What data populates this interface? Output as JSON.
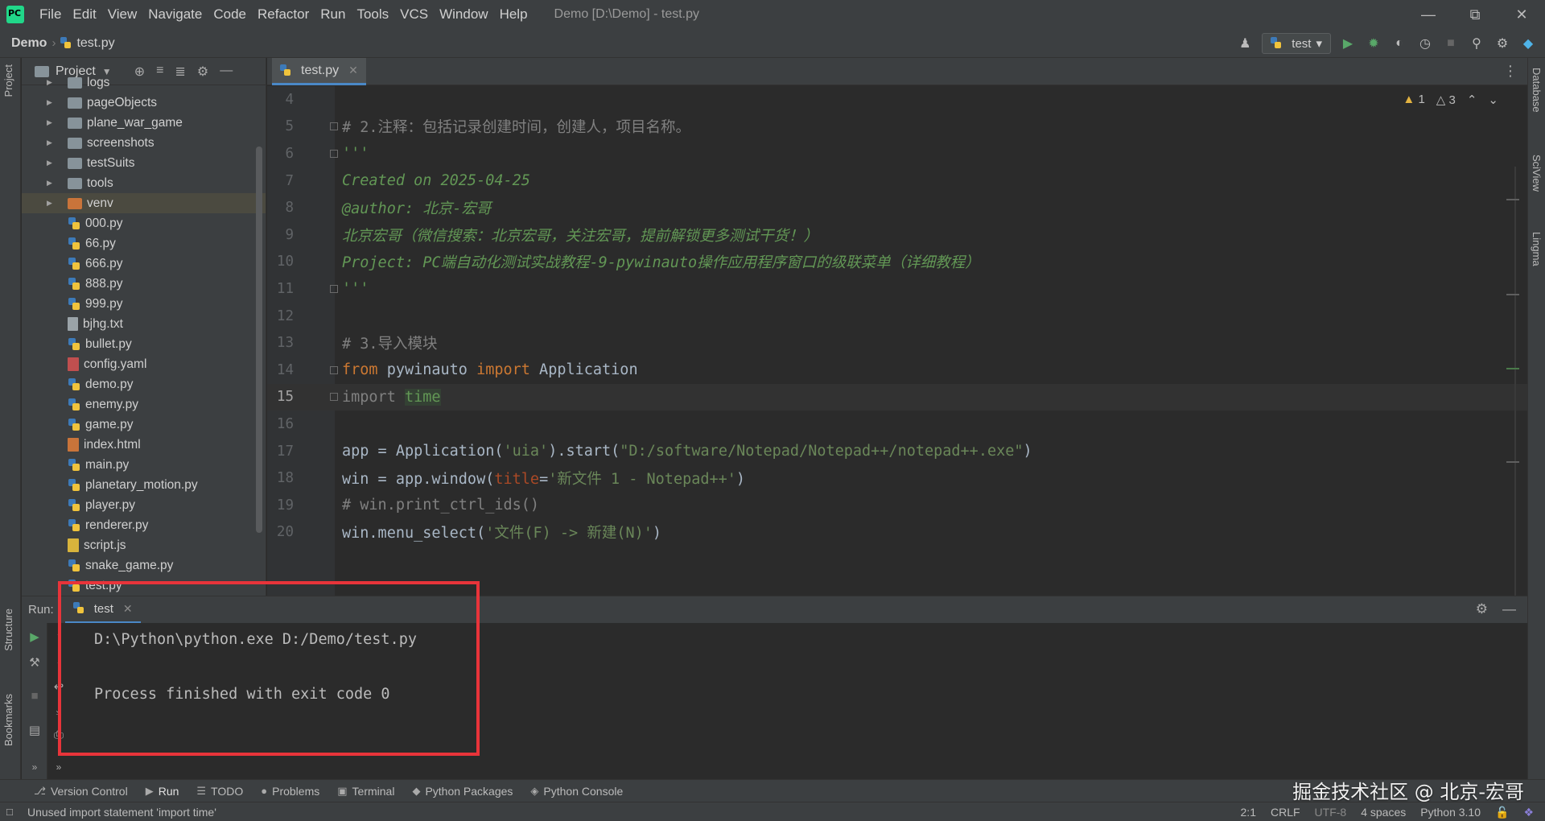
{
  "titlebar": {
    "menu": [
      "File",
      "Edit",
      "View",
      "Navigate",
      "Code",
      "Refactor",
      "Run",
      "Tools",
      "VCS",
      "Window",
      "Help"
    ],
    "window_title": "Demo [D:\\Demo] - test.py"
  },
  "navbar": {
    "project": "Demo",
    "file": "test.py",
    "run_config": "test"
  },
  "project_panel": {
    "title": "Project",
    "folders": [
      {
        "label": "logs"
      },
      {
        "label": "pageObjects"
      },
      {
        "label": "plane_war_game"
      },
      {
        "label": "screenshots"
      },
      {
        "label": "testSuits"
      },
      {
        "label": "tools"
      },
      {
        "label": "venv"
      }
    ],
    "files": [
      {
        "label": "000.py",
        "type": "py"
      },
      {
        "label": "66.py",
        "type": "py"
      },
      {
        "label": "666.py",
        "type": "py"
      },
      {
        "label": "888.py",
        "type": "py"
      },
      {
        "label": "999.py",
        "type": "py"
      },
      {
        "label": "bjhg.txt",
        "type": "txt"
      },
      {
        "label": "bullet.py",
        "type": "py"
      },
      {
        "label": "config.yaml",
        "type": "yaml"
      },
      {
        "label": "demo.py",
        "type": "py"
      },
      {
        "label": "enemy.py",
        "type": "py"
      },
      {
        "label": "game.py",
        "type": "py"
      },
      {
        "label": "index.html",
        "type": "html"
      },
      {
        "label": "main.py",
        "type": "py"
      },
      {
        "label": "planetary_motion.py",
        "type": "py"
      },
      {
        "label": "player.py",
        "type": "py"
      },
      {
        "label": "renderer.py",
        "type": "py"
      },
      {
        "label": "script.js",
        "type": "js"
      },
      {
        "label": "snake_game.py",
        "type": "py"
      },
      {
        "label": "test.py",
        "type": "py"
      }
    ]
  },
  "editor": {
    "tab_label": "test.py",
    "warnings": "1",
    "weak_warnings": "3",
    "lines": [
      {
        "num": "4",
        "text": ""
      },
      {
        "num": "5",
        "text": "# 2.注释：包括记录创建时间，创建人，项目名称。"
      },
      {
        "num": "6",
        "text": "'''"
      },
      {
        "num": "7",
        "text": "Created on 2025-04-25"
      },
      {
        "num": "8",
        "text": "@author: 北京-宏哥"
      },
      {
        "num": "9",
        "text": "北京宏哥（微信搜索：北京宏哥，关注宏哥，提前解锁更多测试干货！）"
      },
      {
        "num": "10",
        "text": "Project: PC端自动化测试实战教程-9-pywinauto操作应用程序窗口的级联菜单（详细教程）"
      },
      {
        "num": "11",
        "text": "'''"
      },
      {
        "num": "12",
        "text": ""
      },
      {
        "num": "13",
        "text": "# 3.导入模块"
      },
      {
        "num": "14",
        "kw1": "from",
        "mid": " pywinauto ",
        "kw2": "import",
        "rest": " Application"
      },
      {
        "num": "15",
        "unused_kw": "import ",
        "unused_mod": "time"
      },
      {
        "num": "16",
        "text": ""
      },
      {
        "num": "17",
        "pre": "app = Application(",
        "s1": "'uia'",
        "mid": ").start(",
        "s2": "\"D:/software/Notepad/Notepad++/notepad++.exe\"",
        "post": ")"
      },
      {
        "num": "18",
        "pre": "win = app.window(",
        "param": "title",
        "eq": "=",
        "s1": "'新文件 1 - Notepad++'",
        "post": ")"
      },
      {
        "num": "19",
        "text": "# win.print_ctrl_ids()"
      },
      {
        "num": "20",
        "pre": "win.menu_select(",
        "s1": "'文件(F) -> 新建(N)'",
        "post": ")"
      }
    ]
  },
  "run_panel": {
    "label": "Run:",
    "tab_label": "test",
    "console": [
      "D:\\Python\\python.exe D:/Demo/test.py",
      "",
      "Process finished with exit code 0"
    ]
  },
  "tool_tabs": [
    "Version Control",
    "Run",
    "TODO",
    "Problems",
    "Terminal",
    "Python Packages",
    "Python Console"
  ],
  "left_strip": {
    "project": "Project",
    "structure": "Structure",
    "bookmarks": "Bookmarks"
  },
  "right_strip": {
    "database": "Database",
    "sciview": "SciView",
    "lingma": "Lingma"
  },
  "statusbar": {
    "message": "Unused import statement 'import time'",
    "position": "2:1",
    "line_sep": "CRLF",
    "encoding": "UTF-8",
    "indent": "4 spaces",
    "interpreter": "Python 3.10"
  },
  "watermark": "掘金技术社区 @ 北京-宏哥",
  "colors": {
    "accent": "#4a88c7",
    "highlight": "#e8343a",
    "run_green": "#59a869"
  }
}
